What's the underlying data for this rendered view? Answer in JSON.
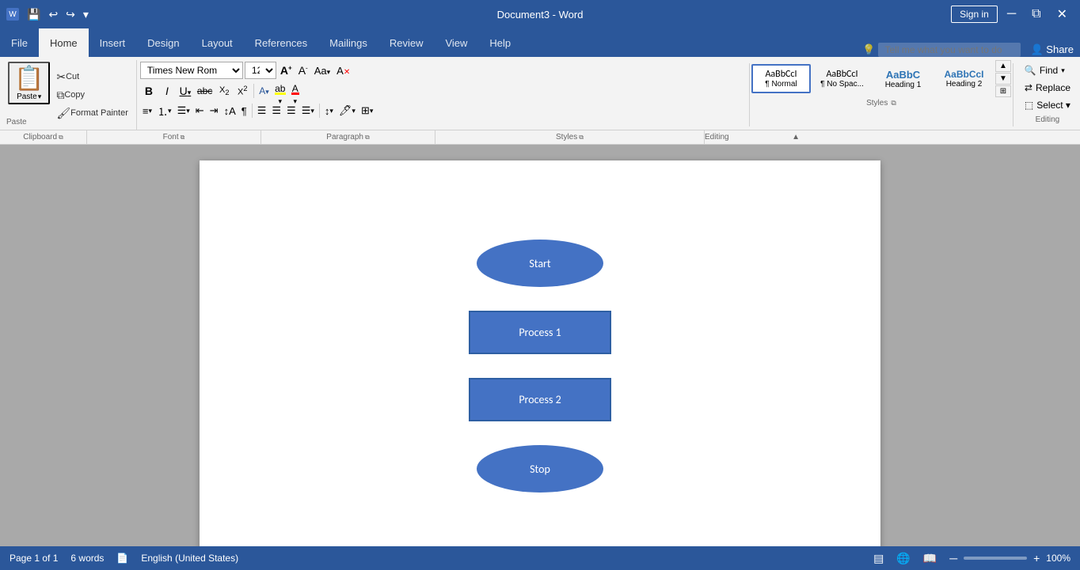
{
  "titlebar": {
    "doc_title": "Document3  -  Word",
    "sign_in": "Sign in",
    "save_icon": "💾",
    "undo_icon": "↩",
    "redo_icon": "↪"
  },
  "tabs": {
    "file": "File",
    "home": "Home",
    "insert": "Insert",
    "design": "Design",
    "layout": "Layout",
    "references": "References",
    "mailings": "Mailings",
    "review": "Review",
    "view": "View",
    "help": "Help",
    "active": "Home"
  },
  "clipboard": {
    "paste_label": "Paste",
    "cut_icon": "✂",
    "copy_icon": "⧉",
    "format_painter_icon": "🖌"
  },
  "font": {
    "font_name": "Times New Rom",
    "font_size": "12",
    "grow_icon": "A",
    "shrink_icon": "A",
    "clear_icon": "A",
    "bold": "B",
    "italic": "I",
    "underline": "U",
    "strike": "abc",
    "sub": "X₂",
    "sup": "X²",
    "font_color": "A",
    "highlight": "ab"
  },
  "paragraph": {
    "label": "Paragraph"
  },
  "styles": {
    "label": "Styles",
    "normal_label": "¶ Normal",
    "nospace_label": "¶ No Spac...",
    "heading1_label": "Heading 1",
    "heading2_label": "Heading 2",
    "sample_normal": "AaBbCcI",
    "sample_nospace": "AaBbCcI",
    "sample_h1": "AaBbC",
    "sample_h2": "AaBbCcI"
  },
  "editing": {
    "label": "Editing",
    "find_label": "Find",
    "replace_label": "Replace",
    "select_label": "Select ▾"
  },
  "tellme": {
    "placeholder": "Tell me what you want to do"
  },
  "share": {
    "label": "Share"
  },
  "document": {
    "shapes": [
      {
        "id": "start",
        "label": "Start",
        "type": "oval"
      },
      {
        "id": "process1",
        "label": "Process 1",
        "type": "rect"
      },
      {
        "id": "process2",
        "label": "Process 2",
        "type": "rect"
      },
      {
        "id": "stop",
        "label": "Stop",
        "type": "oval"
      }
    ]
  },
  "statusbar": {
    "page_info": "Page 1 of 1",
    "word_count": "6 words",
    "language": "English (United States)",
    "zoom": "100%"
  }
}
